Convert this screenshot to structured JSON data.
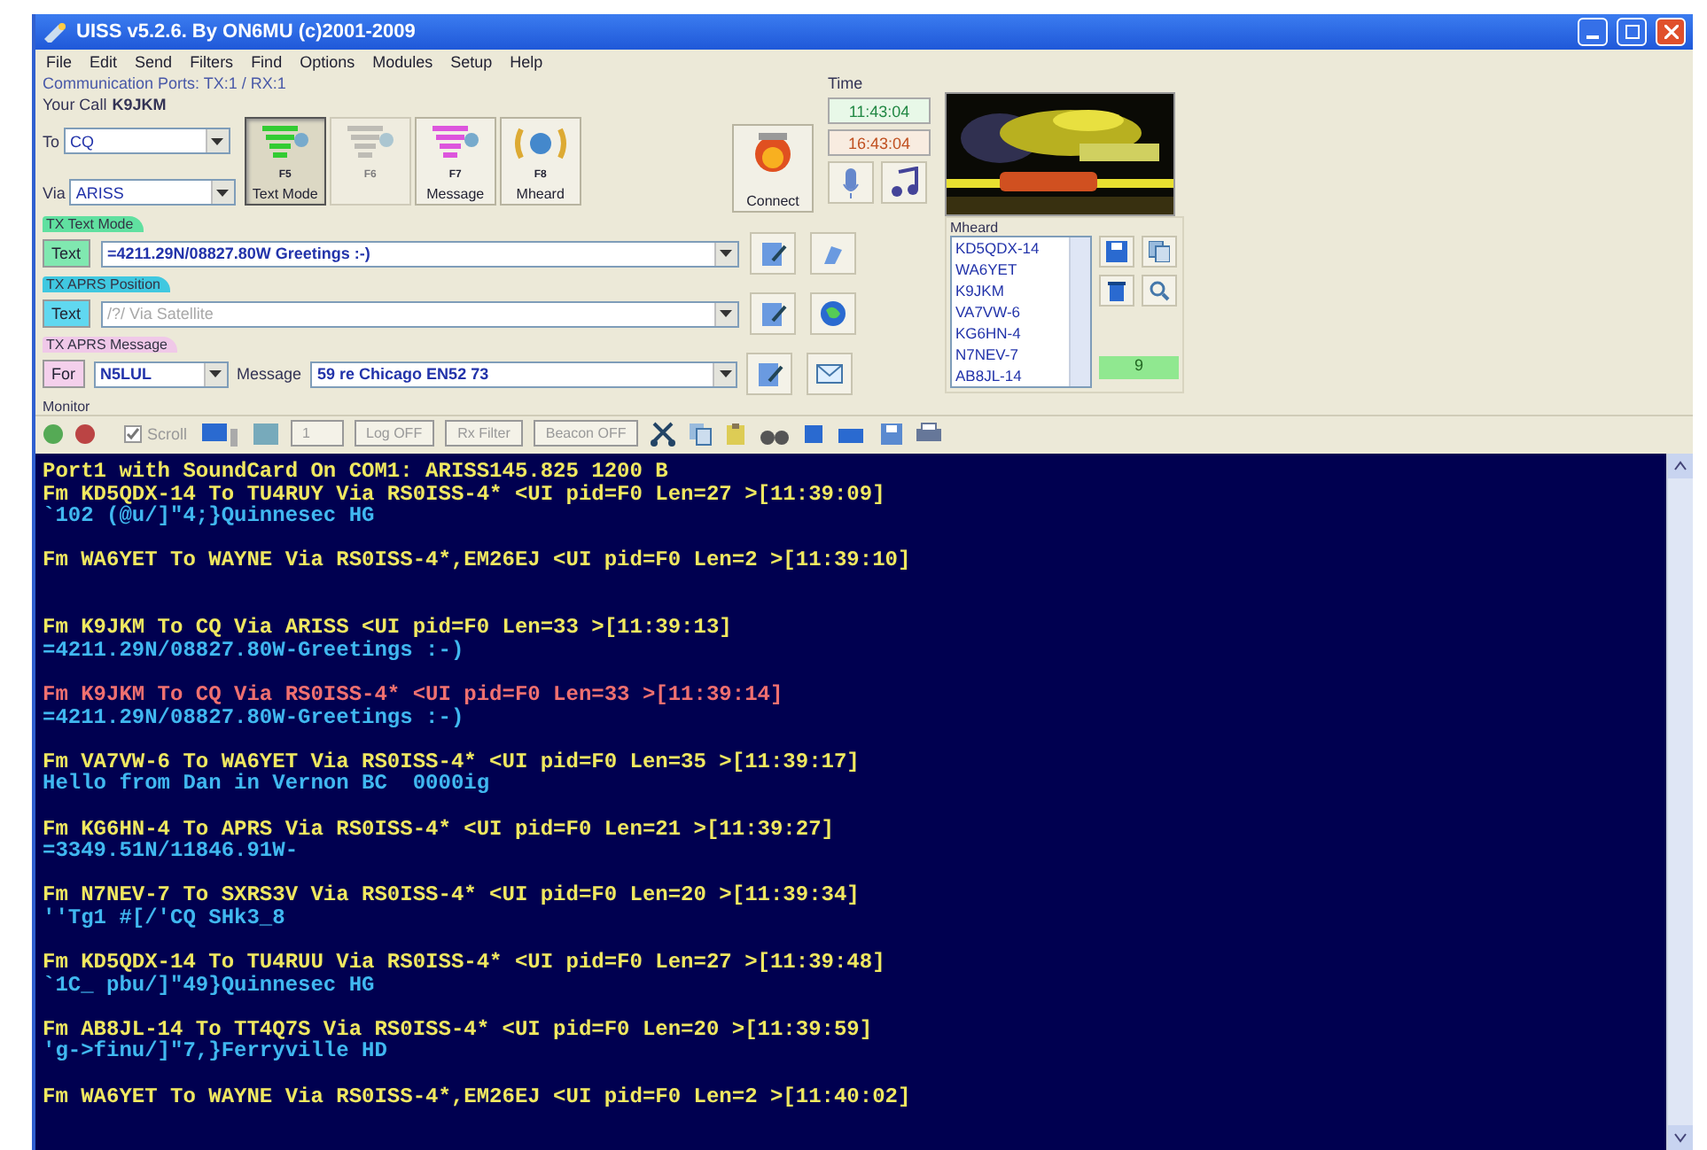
{
  "window": {
    "title": "UISS v5.2.6. By ON6MU (c)2001-2009"
  },
  "menu": [
    "File",
    "Edit",
    "Send",
    "Filters",
    "Find",
    "Options",
    "Modules",
    "Setup",
    "Help"
  ],
  "connection": {
    "ports_label": "Communication Ports: TX:1 / RX:1",
    "call_label": "Your Call",
    "call": "K9JKM",
    "to_label": "To",
    "to": "CQ",
    "via_label": "Via",
    "via": "ARISS"
  },
  "modes": [
    {
      "kind": "text",
      "label": "Text Mode",
      "key": "F5",
      "selected": true,
      "disabled": false
    },
    {
      "kind": "unproto",
      "key": "F6",
      "selected": false,
      "disabled": true
    },
    {
      "kind": "message",
      "label": "Message",
      "key": "F7",
      "selected": false,
      "disabled": false
    },
    {
      "kind": "mheard",
      "label": "Mheard",
      "key": "F8",
      "selected": false,
      "disabled": false
    }
  ],
  "connect": {
    "label": "Connect"
  },
  "time": {
    "label": "Time",
    "local": "11:43:04",
    "utc": "16:43:04"
  },
  "tx_text": {
    "title": "TX Text Mode",
    "button": "Text",
    "value": "=4211.29N/08827.80W Greetings :-)"
  },
  "tx_position": {
    "title": "TX APRS Position",
    "button": "Text",
    "value": "/?/ Via Satellite",
    "disabled": true
  },
  "tx_message": {
    "title": "TX APRS Message",
    "for_label": "For",
    "for": "N5LUL",
    "message_label": "Message",
    "value": "59 re Chicago EN52 73"
  },
  "mheard": {
    "title": "Mheard",
    "stations": [
      "KD5QDX-14",
      "WA6YET",
      "K9JKM",
      "VA7VW-6",
      "KG6HN-4",
      "N7NEV-7",
      "AB8JL-14"
    ],
    "count": "9"
  },
  "monitor": {
    "title": "Monitor",
    "scroll": {
      "label": "Scroll",
      "checked": true
    },
    "page": "1",
    "log": "Log OFF",
    "filter": "Rx Filter",
    "beacon": "Beacon OFF",
    "status": "Port1 with SoundCard On COM1: ARISS145.825 1200 B",
    "packets": [
      {
        "header": "Fm KD5QDX-14 To TU4RUY Via RS0ISS-4* <UI pid=F0 Len=27 >[11:39:09]",
        "payload": "`102 (@u/]\"4;}Quinnesec HG",
        "color": "#f0e860"
      },
      {
        "header": "Fm WA6YET To WAYNE Via RS0ISS-4*,EM26EJ <UI pid=F0 Len=2 >[11:39:10]",
        "color": "#f0e860"
      },
      {
        "header": "Fm K9JKM To CQ Via ARISS <UI pid=F0 Len=33 >[11:39:13]",
        "payload": "=4211.29N/08827.80W-Greetings :-)",
        "color": "#f0e860"
      },
      {
        "header": "Fm K9JKM To CQ Via RS0ISS-4* <UI pid=F0 Len=33 >[11:39:14]",
        "payload": "=4211.29N/08827.80W-Greetings :-)",
        "color": "#f07070"
      },
      {
        "header": "Fm VA7VW-6 To WA6YET Via RS0ISS-4* <UI pid=F0 Len=35 >[11:39:17]",
        "payload": "Hello from Dan in Vernon BC  0000ig",
        "color": "#f0e860"
      },
      {
        "header": "Fm KG6HN-4 To APRS Via RS0ISS-4* <UI pid=F0 Len=21 >[11:39:27]",
        "payload": "=3349.51N/11846.91W-",
        "color": "#f0e860"
      },
      {
        "header": "Fm N7NEV-7 To SXRS3V Via RS0ISS-4* <UI pid=F0 Len=20 >[11:39:34]",
        "payload": "''Tg1 #[/'CQ SHk3_8",
        "color": "#f0e860"
      },
      {
        "header": "Fm KD5QDX-14 To TU4RUU Via RS0ISS-4* <UI pid=F0 Len=27 >[11:39:48]",
        "payload": "`1C_ pbu/]\"49}Quinnesec HG",
        "color": "#f0e860"
      },
      {
        "header": "Fm AB8JL-14 To TT4Q7S Via RS0ISS-4* <UI pid=F0 Len=20 >[11:39:59]",
        "payload": "'g->finu/]\"7,}Ferryville HD",
        "color": "#f0e860"
      },
      {
        "header": "Fm WA6YET To WAYNE Via RS0ISS-4*,EM26EJ <UI pid=F0 Len=2 >[11:40:02]",
        "color": "#f0e860"
      }
    ]
  }
}
